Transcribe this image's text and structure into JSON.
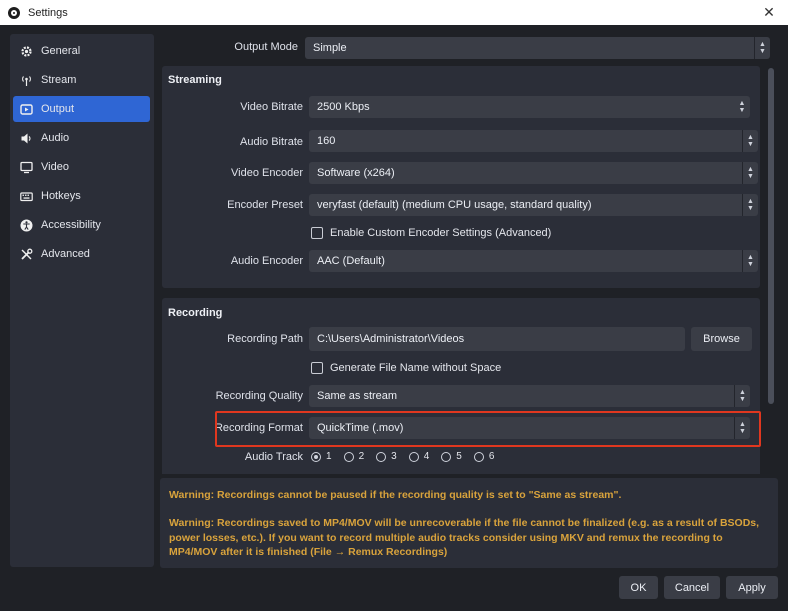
{
  "window": {
    "title": "Settings",
    "close_glyph": "✕"
  },
  "sidebar": {
    "items": [
      {
        "label": "General",
        "icon": "gear-icon"
      },
      {
        "label": "Stream",
        "icon": "antenna-icon"
      },
      {
        "label": "Output",
        "icon": "output-icon",
        "active": true
      },
      {
        "label": "Audio",
        "icon": "speaker-icon"
      },
      {
        "label": "Video",
        "icon": "monitor-icon"
      },
      {
        "label": "Hotkeys",
        "icon": "keyboard-icon"
      },
      {
        "label": "Accessibility",
        "icon": "accessibility-icon"
      },
      {
        "label": "Advanced",
        "icon": "tools-icon"
      }
    ]
  },
  "output_mode": {
    "label": "Output Mode",
    "value": "Simple"
  },
  "streaming": {
    "title": "Streaming",
    "video_bitrate": {
      "label": "Video Bitrate",
      "value": "2500 Kbps"
    },
    "audio_bitrate": {
      "label": "Audio Bitrate",
      "value": "160"
    },
    "video_encoder": {
      "label": "Video Encoder",
      "value": "Software (x264)"
    },
    "encoder_preset": {
      "label": "Encoder Preset",
      "value": "veryfast (default) (medium CPU usage, standard quality)"
    },
    "custom_encoder": {
      "label": "Enable Custom Encoder Settings (Advanced)",
      "checked": false
    },
    "audio_encoder": {
      "label": "Audio Encoder",
      "value": "AAC (Default)"
    }
  },
  "recording": {
    "title": "Recording",
    "path": {
      "label": "Recording Path",
      "value": "C:\\Users\\Administrator\\Videos",
      "browse_label": "Browse"
    },
    "no_space": {
      "label": "Generate File Name without Space",
      "checked": false
    },
    "quality": {
      "label": "Recording Quality",
      "value": "Same as stream"
    },
    "format": {
      "label": "Recording Format",
      "value": "QuickTime (.mov)"
    },
    "audio_track": {
      "label": "Audio Track",
      "tracks": [
        "1",
        "2",
        "3",
        "4",
        "5",
        "6"
      ],
      "selected": "1"
    }
  },
  "warnings": {
    "paused": "Warning: Recordings cannot be paused if the recording quality is set to \"Same as stream\".",
    "mp4": "Warning: Recordings saved to MP4/MOV will be unrecoverable if the file cannot be finalized (e.g. as a result of BSODs, power losses, etc.). If you want to record multiple audio tracks consider using MKV and remux the recording to MP4/MOV after it is finished (File → Remux Recordings)"
  },
  "footer": {
    "ok": "OK",
    "cancel": "Cancel",
    "apply": "Apply"
  },
  "colors": {
    "accent": "#2f66d4",
    "warning": "#d9a33c",
    "highlight": "#e0371f"
  }
}
